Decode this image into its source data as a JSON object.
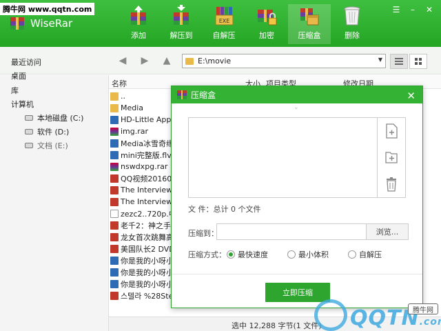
{
  "watermark": {
    "site_label": "腾牛网 www.qqtn.com",
    "logo_text": "QQTN",
    "logo_suffix": ".com",
    "tag": "腾牛网"
  },
  "app": {
    "title": "WiseRar"
  },
  "toolbar": [
    {
      "label": "添加",
      "icon": "add-archive-icon"
    },
    {
      "label": "解压到",
      "icon": "extract-icon"
    },
    {
      "label": "自解压",
      "icon": "sfx-exe-icon"
    },
    {
      "label": "加密",
      "icon": "encrypt-icon"
    },
    {
      "label": "压缩盒",
      "icon": "compress-box-icon"
    },
    {
      "label": "删除",
      "icon": "trash-icon"
    }
  ],
  "window_controls": {
    "menu": "☰",
    "minimize": "–",
    "close": "✕"
  },
  "nav": {
    "path": "E:\\movie"
  },
  "sidebar": [
    {
      "label": "最近访问"
    },
    {
      "label": "桌面"
    },
    {
      "label": "库"
    },
    {
      "label": "计算机"
    },
    {
      "label": "本地磁盘 (C:)"
    },
    {
      "label": "软件 (D:)"
    },
    {
      "label": "文档 (E:)"
    }
  ],
  "file_columns": {
    "name": "名称",
    "size": "大小",
    "type": "项目类型",
    "modified": "修改日期"
  },
  "files": [
    {
      "name": "..",
      "kind": "folder"
    },
    {
      "name": "Media",
      "kind": "folder"
    },
    {
      "name": "HD-Little Apple",
      "kind": "video"
    },
    {
      "name": "img.rar",
      "kind": "rar"
    },
    {
      "name": "Media冰雪奇缘 B",
      "kind": "video"
    },
    {
      "name": "mini完整版.flv",
      "kind": "video"
    },
    {
      "name": "nswdxpg.rar",
      "kind": "rar"
    },
    {
      "name": "QQ视频2016022",
      "kind": "mp4"
    },
    {
      "name": "The Interview (1",
      "kind": "mp4"
    },
    {
      "name": "The Interview (1",
      "kind": "mp4"
    },
    {
      "name": "zezc2..720p.中英",
      "kind": "file"
    },
    {
      "name": "老千2：神之手.H",
      "kind": "mp4"
    },
    {
      "name": "龙女首次跳舞高清",
      "kind": "mp4"
    },
    {
      "name": "美国队长2 DVDs",
      "kind": "mp4"
    },
    {
      "name": "你是我的小呀小苹",
      "kind": "video"
    },
    {
      "name": "你是我的小呀小苹",
      "kind": "video"
    },
    {
      "name": "你是我的小呀小苹",
      "kind": "video"
    },
    {
      "name": "스텔라 %28Stella",
      "kind": "mp4"
    }
  ],
  "status": {
    "text": "选中  12,288 字节(1 文件)"
  },
  "dialog": {
    "title": "压缩盒",
    "close": "✕",
    "file_count": "文  件：总计 0 个文件",
    "dest_label": "压缩到：",
    "dest_value": "",
    "browse_label": "浏览...",
    "mode_label": "压缩方式：",
    "modes": [
      {
        "label": "最快速度",
        "selected": true
      },
      {
        "label": "最小体积",
        "selected": false
      },
      {
        "label": "自解压",
        "selected": false
      }
    ],
    "start_label": "立即压缩"
  },
  "colors": {
    "green": "#33b233",
    "green_dark": "#24a524",
    "watermark_blue": "#3fa9e0"
  }
}
